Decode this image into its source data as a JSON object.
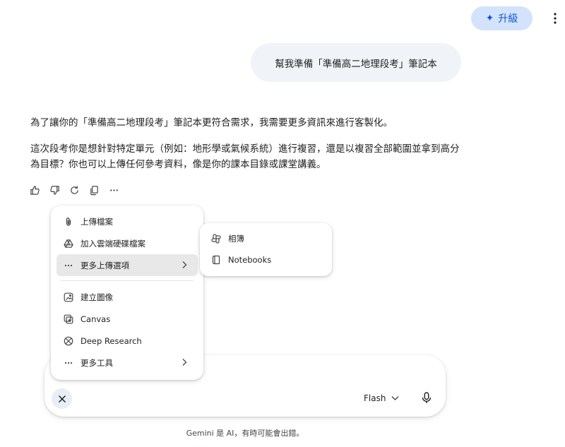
{
  "header": {
    "upgrade_label": "升級",
    "upgrade_icon": "sparkle-icon",
    "menu_icon": "more-vert-icon"
  },
  "conversation": {
    "user_message": "幫我準備「準備高二地理段考」筆記本",
    "response_p1": "為了讓你的「準備高二地理段考」筆記本更符合需求，我需要更多資訊來進行客製化。",
    "response_p2": "這次段考你是想針對特定單元（例如：地形學或氣候系統）進行複習，還是以複習全部範圍並拿到高分為目標？你也可以上傳任何參考資料，像是你的課本目錄或課堂講義。"
  },
  "response_actions": [
    "thumbs-up-icon",
    "thumbs-down-icon",
    "regenerate-icon",
    "copy-icon",
    "more-horiz-icon"
  ],
  "tools_menu": {
    "items": [
      {
        "label": "上傳檔案",
        "icon": "paperclip-icon"
      },
      {
        "label": "加入雲端硬碟檔案",
        "icon": "drive-icon"
      },
      {
        "label": "更多上傳選項",
        "icon": "more-horiz-icon",
        "has_submenu": true,
        "active": true
      },
      {
        "label": "建立圖像",
        "icon": "image-icon"
      },
      {
        "label": "Canvas",
        "icon": "canvas-icon"
      },
      {
        "label": "Deep Research",
        "icon": "deep-research-icon"
      },
      {
        "label": "更多工具",
        "icon": "more-horiz-icon",
        "has_submenu": true
      }
    ]
  },
  "upload_submenu": {
    "items": [
      {
        "label": "相簿",
        "icon": "photos-icon"
      },
      {
        "label": "Notebooks",
        "icon": "notebook-icon"
      }
    ]
  },
  "composer": {
    "model_label": "Flash",
    "close_icon": "close-icon",
    "mic_icon": "mic-icon"
  },
  "footer": {
    "disclaimer": "Gemini 是 AI，有時可能會出錯。"
  },
  "colors": {
    "accent": "#0b57d0",
    "upgrade_bg": "#d3e3fd",
    "bubble_bg": "#f0f4f9",
    "active_item_bg": "#e8e8e8"
  }
}
